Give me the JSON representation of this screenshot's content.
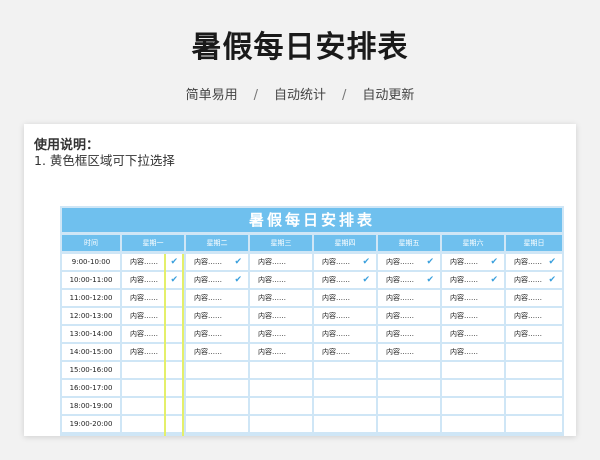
{
  "header": {
    "title": "暑假每日安排表",
    "features": [
      "简单易用",
      "自动统计",
      "自动更新"
    ],
    "separator": "/"
  },
  "instructions": {
    "title": "使用说明：",
    "items": [
      "1. 黄色框区域可下拉选择"
    ]
  },
  "schedule": {
    "title": "暑假每日安排表",
    "columns": [
      "时间",
      "星期一",
      "星期二",
      "星期三",
      "星期四",
      "星期五",
      "星期六",
      "星期日"
    ],
    "rows": [
      {
        "time": "9:00-10:00",
        "cells": [
          "内容……",
          "内容……",
          "内容……",
          "内容……",
          "内容……",
          "内容……",
          "内容……"
        ],
        "checked": [
          true,
          true,
          false,
          true,
          true,
          true,
          true
        ]
      },
      {
        "time": "10:00-11:00",
        "cells": [
          "内容……",
          "内容……",
          "内容……",
          "内容……",
          "内容……",
          "内容……",
          "内容……"
        ],
        "checked": [
          true,
          true,
          false,
          true,
          true,
          true,
          true
        ]
      },
      {
        "time": "11:00-12:00",
        "cells": [
          "内容……",
          "内容……",
          "内容……",
          "内容……",
          "内容……",
          "内容……",
          "内容……"
        ],
        "checked": [
          false,
          false,
          false,
          false,
          false,
          false,
          false
        ]
      },
      {
        "time": "12:00-13:00",
        "cells": [
          "内容……",
          "内容……",
          "内容……",
          "内容……",
          "内容……",
          "内容……",
          "内容……"
        ],
        "checked": [
          false,
          false,
          false,
          false,
          false,
          false,
          false
        ]
      },
      {
        "time": "13:00-14:00",
        "cells": [
          "内容……",
          "内容……",
          "内容……",
          "内容……",
          "内容……",
          "内容……",
          "内容……"
        ],
        "checked": [
          false,
          false,
          false,
          false,
          false,
          false,
          false
        ]
      },
      {
        "time": "14:00-15:00",
        "cells": [
          "内容……",
          "内容……",
          "内容……",
          "内容……",
          "内容……",
          "内容……",
          ""
        ],
        "checked": [
          false,
          false,
          false,
          false,
          false,
          false,
          false
        ]
      },
      {
        "time": "15:00-16:00",
        "cells": [
          "",
          "",
          "",
          "",
          "",
          "",
          ""
        ],
        "checked": [
          false,
          false,
          false,
          false,
          false,
          false,
          false
        ]
      },
      {
        "time": "16:00-17:00",
        "cells": [
          "",
          "",
          "",
          "",
          "",
          "",
          ""
        ],
        "checked": [
          false,
          false,
          false,
          false,
          false,
          false,
          false
        ]
      },
      {
        "time": "18:00-19:00",
        "cells": [
          "",
          "",
          "",
          "",
          "",
          "",
          ""
        ],
        "checked": [
          false,
          false,
          false,
          false,
          false,
          false,
          false
        ]
      },
      {
        "time": "19:00-20:00",
        "cells": [
          "",
          "",
          "",
          "",
          "",
          "",
          ""
        ],
        "checked": [
          false,
          false,
          false,
          false,
          false,
          false,
          false
        ]
      }
    ],
    "check_icon": "check-icon",
    "colors": {
      "header": "#6fc0ee",
      "grid": "#cfe6f6",
      "dropdown_marker": "#e4ef6a",
      "check": "#3aa0dd"
    }
  }
}
